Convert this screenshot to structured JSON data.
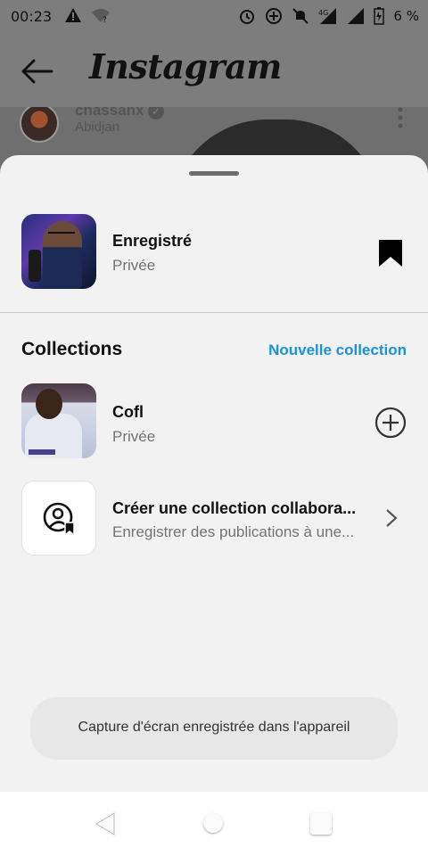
{
  "status_bar": {
    "time": "00:23",
    "network": "4G",
    "battery_text": "6 %",
    "icons": [
      "warning-icon",
      "wifi-unknown-icon",
      "alarm-icon",
      "data-saver-icon",
      "mute-icon",
      "signal-icon",
      "signal-icon-2",
      "battery-charging-icon"
    ]
  },
  "header": {
    "logo_text": "Instagram",
    "back_icon": "arrow-left-icon"
  },
  "post": {
    "username": "chassanx",
    "location": "Abidjan"
  },
  "sheet": {
    "saved": {
      "title": "Enregistré",
      "subtitle": "Privée",
      "icon": "bookmark-filled-icon"
    },
    "collections_header": "Collections",
    "new_collection_label": "Nouvelle collection",
    "collections": [
      {
        "title": "Cofl",
        "subtitle": "Privée",
        "action_icon": "plus-circle-icon"
      }
    ],
    "collaborative": {
      "title": "Créer une collection collabora...",
      "subtitle": "Enregistrer des publications à une...",
      "icon": "user-bookmark-icon",
      "action_icon": "chevron-right-icon"
    },
    "toast": "Capture d'écran enregistrée dans l'appareil"
  },
  "colors": {
    "accent": "#1a92d9",
    "sheet_bg": "#f2f2f2",
    "overlay": "#7d7d7d"
  }
}
